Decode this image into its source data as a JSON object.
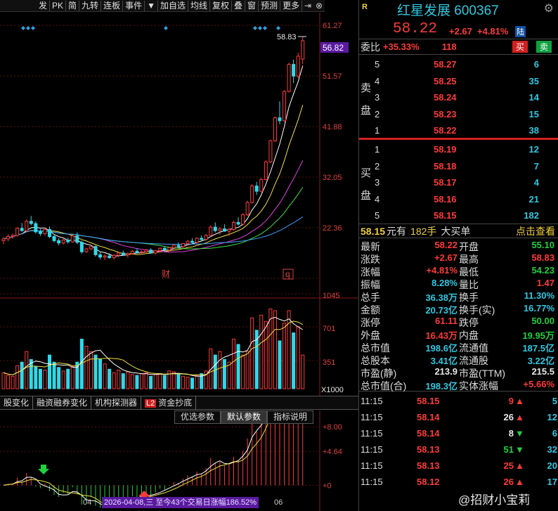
{
  "toolbar": {
    "items": [
      "发",
      "PK",
      "简",
      "九转",
      "连板",
      "事件",
      "▼",
      "加自选",
      "均线",
      "复权",
      "叠",
      "窗",
      "预测",
      "更多"
    ],
    "icons": [
      "dock-icon",
      "close-icon"
    ]
  },
  "main_axis": {
    "ticks": [
      "61.27",
      "51.57",
      "41.88",
      "32.05",
      "22.36"
    ],
    "current_price_tag": "56.82",
    "high_label": "58.83",
    "markers": [
      "财",
      "q"
    ]
  },
  "vol_axis": {
    "ticks": [
      "1045",
      "701",
      "351"
    ],
    "unit": "X1000"
  },
  "ind_axis": {
    "ticks": [
      "+8.00",
      "+4.64",
      "+0"
    ]
  },
  "tabs": [
    "股变化",
    "融资融券变化",
    "机构探测器",
    "资金抄底"
  ],
  "tab_badge": "L2",
  "param_bar": [
    "优选参数",
    "默认参数",
    "指标说明"
  ],
  "bottom": {
    "date_04": "04",
    "date_06": "06",
    "range_text": "2026-04-08,三 至今43个交易日涨幅186.52%"
  },
  "header": {
    "badge": "R",
    "name": "红星发展",
    "code": "600367",
    "price": "58.22",
    "change": "+2.67",
    "change_pct": "+4.81%",
    "market_tag": "陆"
  },
  "weibi": {
    "label": "委比",
    "ratio": "+35.33%",
    "diff": "118",
    "buy": "买",
    "sell": "卖"
  },
  "ask_side_label": [
    "卖",
    "盘"
  ],
  "bid_side_label": [
    "买",
    "盘"
  ],
  "asks": [
    {
      "level": "5",
      "price": "58.27",
      "qty": "6"
    },
    {
      "level": "4",
      "price": "58.25",
      "qty": "35"
    },
    {
      "level": "3",
      "price": "58.24",
      "qty": "14"
    },
    {
      "level": "2",
      "price": "58.23",
      "qty": "15"
    },
    {
      "level": "1",
      "price": "58.22",
      "qty": "38"
    }
  ],
  "bids": [
    {
      "level": "1",
      "price": "58.19",
      "qty": "12"
    },
    {
      "level": "2",
      "price": "58.18",
      "qty": "7"
    },
    {
      "level": "3",
      "price": "58.17",
      "qty": "4"
    },
    {
      "level": "4",
      "price": "58.16",
      "qty": "21"
    },
    {
      "level": "5",
      "price": "58.15",
      "qty": "182"
    }
  ],
  "big_order": {
    "price": "58.15",
    "unit": "元有",
    "qty": "182手",
    "label": "大买单",
    "link": "点击查看"
  },
  "stats": [
    {
      "k1": "最新",
      "v1": "58.22",
      "c1": "red",
      "k2": "开盘",
      "v2": "55.10",
      "c2": "green"
    },
    {
      "k1": "涨跌",
      "v1": "+2.67",
      "c1": "red",
      "k2": "最高",
      "v2": "58.83",
      "c2": "red"
    },
    {
      "k1": "涨幅",
      "v1": "+4.81%",
      "c1": "red",
      "k2": "最低",
      "v2": "54.23",
      "c2": "green"
    },
    {
      "k1": "振幅",
      "v1": "8.28%",
      "c1": "cyan",
      "k2": "量比",
      "v2": "1.47",
      "c2": "red"
    },
    {
      "k1": "总手",
      "v1": "36.38万",
      "c1": "cyan",
      "k2": "换手",
      "v2": "11.30%",
      "c2": "cyan"
    },
    {
      "k1": "金额",
      "v1": "20.73亿",
      "c1": "cyan",
      "k2": "换手(实)",
      "v2": "16.77%",
      "c2": "cyan"
    },
    {
      "k1": "涨停",
      "v1": "61.11",
      "c1": "red",
      "k2": "跌停",
      "v2": "50.00",
      "c2": "green"
    },
    {
      "k1": "外盘",
      "v1": "16.43万",
      "c1": "red",
      "k2": "内盘",
      "v2": "19.95万",
      "c2": "green"
    },
    {
      "k1": "总市值",
      "v1": "198.6亿",
      "c1": "cyan",
      "k2": "流通值",
      "v2": "187.5亿",
      "c2": "cyan"
    },
    {
      "k1": "总股本",
      "v1": "3.41亿",
      "c1": "cyan",
      "k2": "流通股",
      "v2": "3.22亿",
      "c2": "cyan"
    },
    {
      "k1": "市盈(静)",
      "v1": "213.9",
      "c1": "white",
      "k2": "市盈(TTM)",
      "v2": "215.5",
      "c2": "white"
    },
    {
      "k1": "总市值(合)",
      "v1": "198.3亿",
      "c1": "cyan",
      "k2": "实体涨幅",
      "v2": "+5.66%",
      "c2": "red"
    }
  ],
  "ticks": [
    {
      "time": "11:15",
      "price": "58.15",
      "vol": "9",
      "vc": "red",
      "dir": "up",
      "n": "5"
    },
    {
      "time": "11:15",
      "price": "58.14",
      "vol": "26",
      "vc": "white",
      "dir": "up",
      "n": "12"
    },
    {
      "time": "11:15",
      "price": "58.14",
      "vol": "8",
      "vc": "white",
      "dir": "down",
      "n": "6"
    },
    {
      "time": "11:15",
      "price": "58.13",
      "vol": "51",
      "vc": "green",
      "dir": "down",
      "n": "32"
    },
    {
      "time": "11:15",
      "price": "58.13",
      "vol": "25",
      "vc": "red",
      "dir": "up",
      "n": "20"
    },
    {
      "time": "11:15",
      "price": "58.12",
      "vol": "26",
      "vc": "red",
      "dir": "up",
      "n": "17"
    }
  ],
  "watermark": "@招财小宝莉",
  "chart_data": {
    "type": "candlestick",
    "title": "",
    "y_range": [
      18.5,
      63
    ],
    "candles": [
      [
        24.2,
        24.8,
        23.6,
        24.5
      ],
      [
        24.5,
        25.3,
        24.1,
        24.9
      ],
      [
        24.9,
        25.4,
        24.5,
        25.1
      ],
      [
        25.1,
        26.5,
        24.9,
        26.3
      ],
      [
        26.3,
        27.2,
        25.7,
        25.9
      ],
      [
        25.9,
        27.8,
        25.6,
        27.5
      ],
      [
        27.5,
        28.4,
        26.8,
        27.1
      ],
      [
        27.1,
        27.5,
        25.4,
        25.7
      ],
      [
        25.7,
        26.2,
        25.0,
        25.4
      ],
      [
        25.4,
        26.4,
        25.1,
        26.1
      ],
      [
        26.1,
        26.6,
        24.6,
        24.9
      ],
      [
        24.9,
        25.3,
        23.9,
        24.2
      ],
      [
        24.2,
        24.6,
        23.4,
        23.8
      ],
      [
        23.8,
        24.5,
        23.5,
        24.3
      ],
      [
        24.3,
        24.7,
        23.7,
        24.0
      ],
      [
        24.0,
        25.2,
        23.8,
        25.0
      ],
      [
        25.0,
        25.6,
        23.6,
        23.9
      ],
      [
        23.9,
        24.2,
        22.0,
        22.3
      ],
      [
        22.3,
        23.0,
        22.1,
        22.8
      ],
      [
        22.8,
        23.5,
        22.6,
        23.2
      ],
      [
        23.2,
        23.4,
        21.5,
        21.8
      ],
      [
        21.8,
        22.2,
        21.0,
        21.4
      ],
      [
        21.4,
        21.9,
        20.9,
        21.6
      ],
      [
        21.6,
        22.1,
        21.1,
        21.3
      ],
      [
        21.3,
        21.9,
        21.0,
        21.7
      ],
      [
        21.7,
        22.3,
        21.4,
        22.1
      ],
      [
        22.1,
        22.5,
        21.6,
        21.8
      ],
      [
        21.8,
        22.2,
        21.3,
        22.0
      ],
      [
        22.0,
        22.6,
        21.8,
        22.4
      ],
      [
        22.4,
        22.9,
        22.0,
        22.2
      ],
      [
        22.2,
        22.5,
        21.8,
        22.3
      ],
      [
        22.3,
        22.8,
        22.1,
        22.6
      ],
      [
        22.6,
        22.9,
        22.0,
        22.1
      ],
      [
        22.1,
        22.6,
        21.8,
        22.5
      ],
      [
        22.5,
        23.0,
        22.2,
        22.9
      ],
      [
        22.9,
        23.2,
        22.4,
        22.6
      ],
      [
        22.6,
        23.1,
        22.3,
        23.0
      ],
      [
        23.0,
        23.6,
        22.8,
        23.4
      ],
      [
        23.4,
        23.9,
        23.0,
        23.2
      ],
      [
        23.2,
        23.8,
        22.9,
        23.7
      ],
      [
        23.7,
        24.3,
        23.4,
        24.1
      ],
      [
        24.1,
        24.6,
        23.7,
        23.9
      ],
      [
        23.9,
        24.8,
        23.7,
        24.6
      ],
      [
        24.6,
        25.1,
        24.1,
        24.4
      ],
      [
        24.4,
        25.3,
        24.2,
        25.1
      ],
      [
        25.1,
        26.8,
        24.9,
        26.5
      ],
      [
        26.5,
        27.3,
        25.6,
        25.9
      ],
      [
        25.9,
        26.5,
        25.2,
        26.2
      ],
      [
        26.2,
        27.0,
        25.7,
        25.8
      ],
      [
        25.8,
        26.3,
        25.0,
        26.1
      ],
      [
        26.1,
        27.6,
        25.9,
        27.3
      ],
      [
        27.3,
        28.2,
        26.8,
        27.0
      ],
      [
        27.0,
        28.9,
        26.8,
        28.6
      ],
      [
        28.6,
        31.0,
        28.4,
        30.7
      ],
      [
        30.7,
        33.8,
        30.5,
        33.5
      ],
      [
        33.5,
        34.2,
        32.0,
        32.6
      ],
      [
        32.6,
        34.9,
        32.4,
        34.6
      ],
      [
        34.6,
        37.9,
        34.4,
        37.6
      ],
      [
        37.6,
        41.4,
        37.4,
        41.2
      ],
      [
        41.2,
        45.3,
        41.0,
        45.1
      ],
      [
        45.1,
        47.9,
        44.0,
        44.6
      ],
      [
        44.6,
        49.8,
        44.4,
        49.6
      ],
      [
        49.6,
        54.5,
        49.4,
        54.2
      ],
      [
        54.2,
        55.0,
        51.0,
        52.2
      ],
      [
        52.2,
        56.2,
        51.9,
        55.6
      ],
      [
        55.1,
        58.83,
        54.23,
        58.22
      ]
    ],
    "volume": [
      180,
      150,
      140,
      260,
      300,
      420,
      330,
      250,
      220,
      210,
      380,
      300,
      240,
      200,
      220,
      250,
      300,
      560,
      480,
      420,
      380,
      330,
      280,
      220,
      180,
      210,
      170,
      190,
      160,
      150,
      170,
      180,
      140,
      160,
      170,
      150,
      200,
      190,
      160,
      140,
      130,
      120,
      150,
      170,
      200,
      450,
      380,
      420,
      330,
      300,
      560,
      500,
      380,
      420,
      800,
      660,
      830,
      760,
      900,
      880,
      540,
      740,
      880,
      630,
      700,
      380
    ],
    "vol_range": [
      0,
      1150
    ],
    "indicator_range": [
      -1.5,
      8.5
    ]
  }
}
